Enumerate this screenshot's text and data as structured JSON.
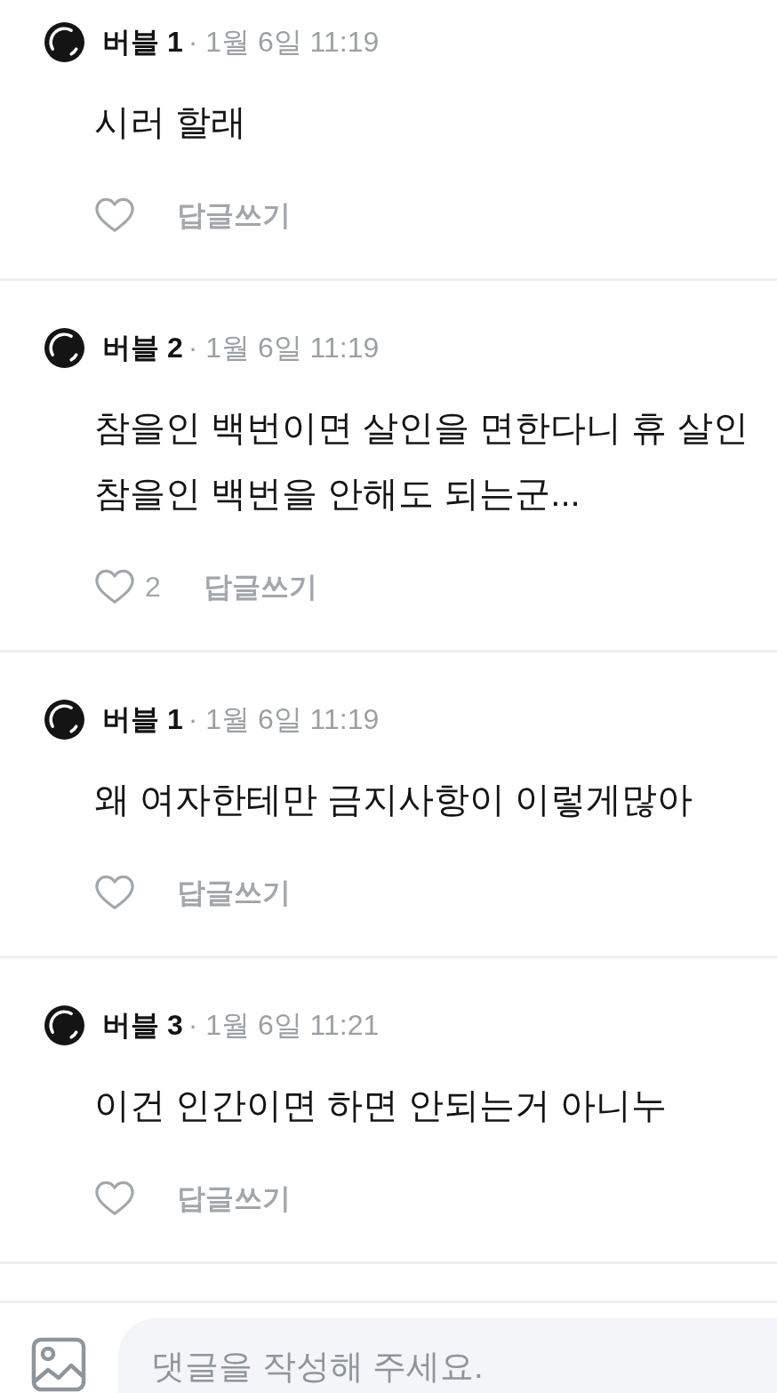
{
  "comments": [
    {
      "author": "버블 1",
      "time": "· 1월 6일 11:19",
      "lines": [
        "시러 할래"
      ],
      "reply_label": "답글쓰기"
    },
    {
      "author": "버블 2",
      "time": "· 1월 6일 11:19",
      "lines": [
        "참을인 백번이면 살인을 면한다니 휴 살인",
        "참을인 백번을 안해도 되는군..."
      ],
      "likes": "2",
      "reply_label": "답글쓰기"
    },
    {
      "author": "버블 1",
      "time": "· 1월 6일 11:19",
      "lines": [
        "왜 여자한테만 금지사항이 이렇게많아"
      ],
      "reply_label": "답글쓰기"
    },
    {
      "author": "버블 3",
      "time": "· 1월 6일 11:21",
      "lines": [
        "이건 인간이면 하면 안되는거 아니누"
      ],
      "reply_label": "답글쓰기"
    }
  ],
  "composer": {
    "placeholder": "댓글을 작성해 주세요."
  }
}
